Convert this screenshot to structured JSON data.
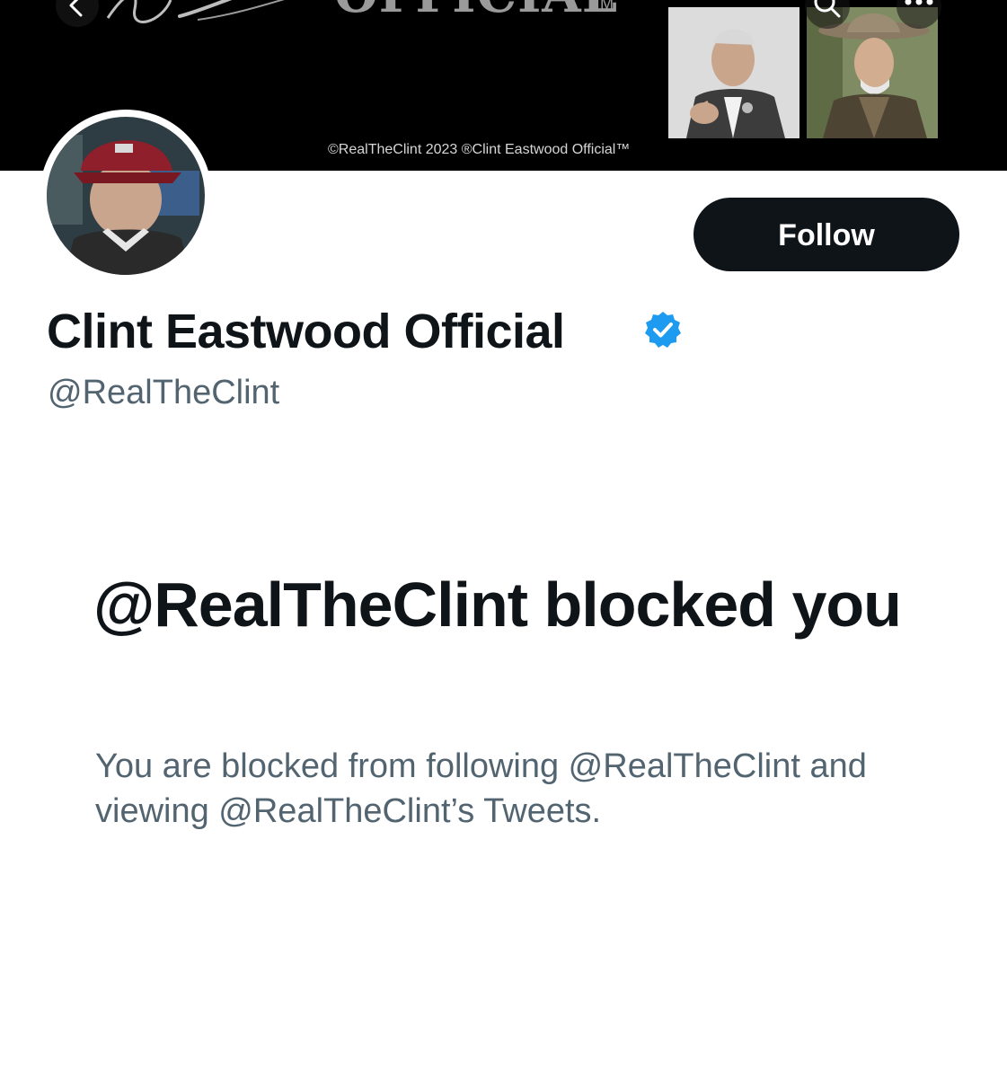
{
  "banner": {
    "wordmark": "OFFICIAL",
    "trademark": "TM",
    "copyright": "©RealTheClint 2023 ®Clint Eastwood Official™"
  },
  "profile": {
    "display_name": "Clint Eastwood Official",
    "handle": "@RealTheClint",
    "verified": true,
    "follow_label": "Follow"
  },
  "blocked": {
    "title": "@RealTheClint blocked you",
    "message": "You are blocked from following @RealTheClint and viewing @RealTheClint’s Tweets."
  },
  "colors": {
    "text_primary": "#0f1419",
    "text_secondary": "#536471",
    "verified_blue": "#1d9bf0",
    "banner_bg": "#000000",
    "follow_bg": "#0f1419"
  },
  "icons": [
    "back-arrow-icon",
    "search-icon",
    "more-icon",
    "verified-badge-icon"
  ]
}
